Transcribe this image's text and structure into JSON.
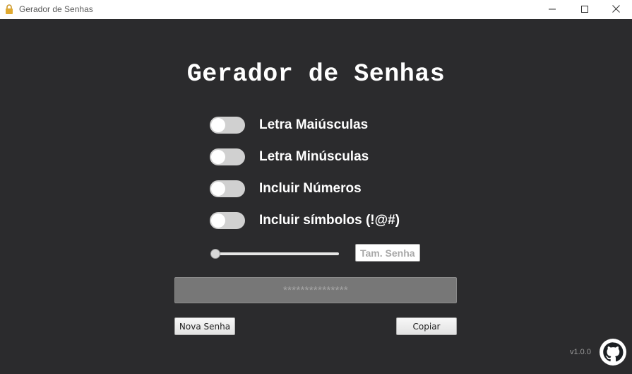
{
  "window": {
    "title": "Gerador de Senhas",
    "icon": "lock-icon",
    "controls": [
      "minimize-icon",
      "maximize-icon",
      "close-icon"
    ]
  },
  "main": {
    "heading": "Gerador de Senhas",
    "options": [
      {
        "label": "Letra Maiúsculas",
        "enabled": false
      },
      {
        "label": "Letra Minúsculas",
        "enabled": false
      },
      {
        "label": "Incluir Números",
        "enabled": false
      },
      {
        "label": "Incluir símbolos (!@#)",
        "enabled": false
      }
    ],
    "length_slider": {
      "value": 0
    },
    "length_input": {
      "placeholder": "Tam. Senha",
      "value": ""
    },
    "password_display": "***************",
    "buttons": {
      "new_password": "Nova Senha",
      "copy": "Copiar"
    },
    "version": "v1.0.0",
    "github_icon": "github-icon"
  },
  "colors": {
    "background": "#2b2b2d",
    "titlebar": "#ffffff",
    "text": "#ffffff",
    "toggle_off": "#d0d0d0",
    "password_box": "#777777"
  }
}
